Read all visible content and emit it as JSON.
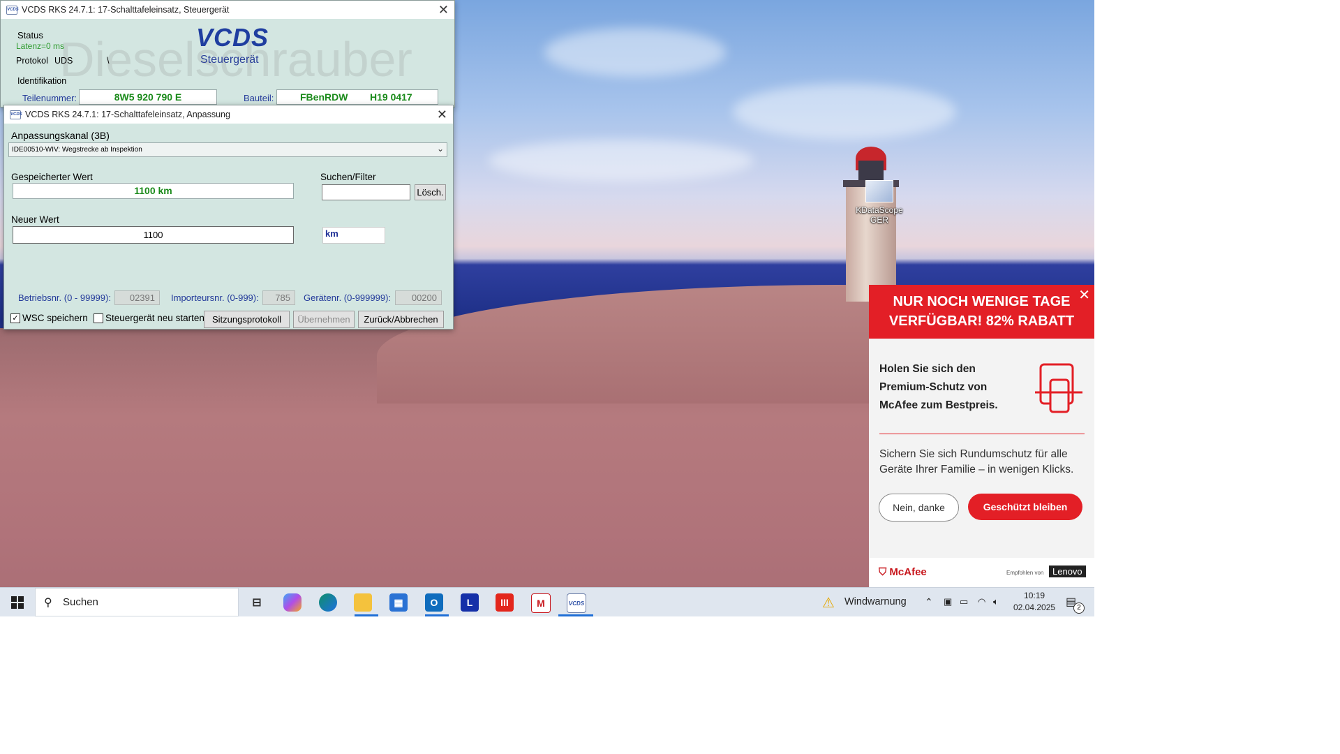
{
  "desktop": {
    "icon_label": "KDataScope GER"
  },
  "vcds_main": {
    "title": "VCDS RKS 24.7.1: 17-Schalttafeleinsatz,  Steuergerät",
    "logo": "VCDS",
    "subtitle": "Steuergerät",
    "watermark": "Dieselschrauber",
    "status_label": "Status",
    "latency": "Latenz=0 ms",
    "protocol_label": "Protokol",
    "protocol_value": "UDS",
    "protocol_extra": "\\",
    "identification_label": "Identifikation",
    "part_number_label": "Teilenummer:",
    "part_number_value": "8W5 920 790 E",
    "component_label": "Bauteil:",
    "component_value": "FBenRDW",
    "component_version": "H19 0417"
  },
  "vcds_adapt": {
    "title": "VCDS RKS 24.7.1: 17-Schalttafeleinsatz,  Anpassung",
    "channel_label": "Anpassungskanal (3B)",
    "channel_value": "IDE00510-WIV: Wegstrecke ab Inspektion",
    "stored_label": "Gespeicherter Wert",
    "stored_value": "1100 km",
    "search_label": "Suchen/Filter",
    "search_value": "",
    "clear_button": "Lösch.",
    "new_label": "Neuer Wert",
    "new_value": "1100",
    "unit": "km",
    "dealer_label": "Betriebsnr. (0 - 99999):",
    "dealer_value": "02391",
    "importer_label": "Importeursnr. (0-999):",
    "importer_value": "785",
    "device_label": "Gerätenr. (0-999999):",
    "device_value": "00200",
    "wsc_label": "WSC speichern",
    "wsc_checked": true,
    "restart_label": "Steuergerät neu starten",
    "restart_checked": false,
    "session_button": "Sitzungsprotokoll",
    "apply_button": "Übernehmen",
    "back_button": "Zurück/Abbrechen"
  },
  "mcafee": {
    "headline": "NUR NOCH WENIGE TAGE VERFÜGBAR! 82% RABATT",
    "title": "Holen Sie sich den Premium-Schutz von McAfee zum Bestpreis.",
    "body": "Sichern Sie sich Rundumschutz für alle Geräte Ihrer Familie – in wenigen Klicks.",
    "decline_button": "Nein, danke",
    "accept_button": "Geschützt bleiben",
    "brand": "McAfee",
    "recommended": "Empfohlen von",
    "partner": "Lenovo",
    "accent": "#e31f26"
  },
  "taskbar": {
    "search_placeholder": "Suchen",
    "weather": "Windwarnung",
    "time": "10:19",
    "date": "02.04.2025",
    "notifications": "2",
    "apps": [
      "task-view-icon",
      "copilot-icon",
      "edge-icon",
      "file-explorer-icon",
      "store-icon",
      "outlook-icon",
      "l-app-icon",
      "red-app-icon",
      "mcafee-icon",
      "vcds-icon"
    ]
  }
}
